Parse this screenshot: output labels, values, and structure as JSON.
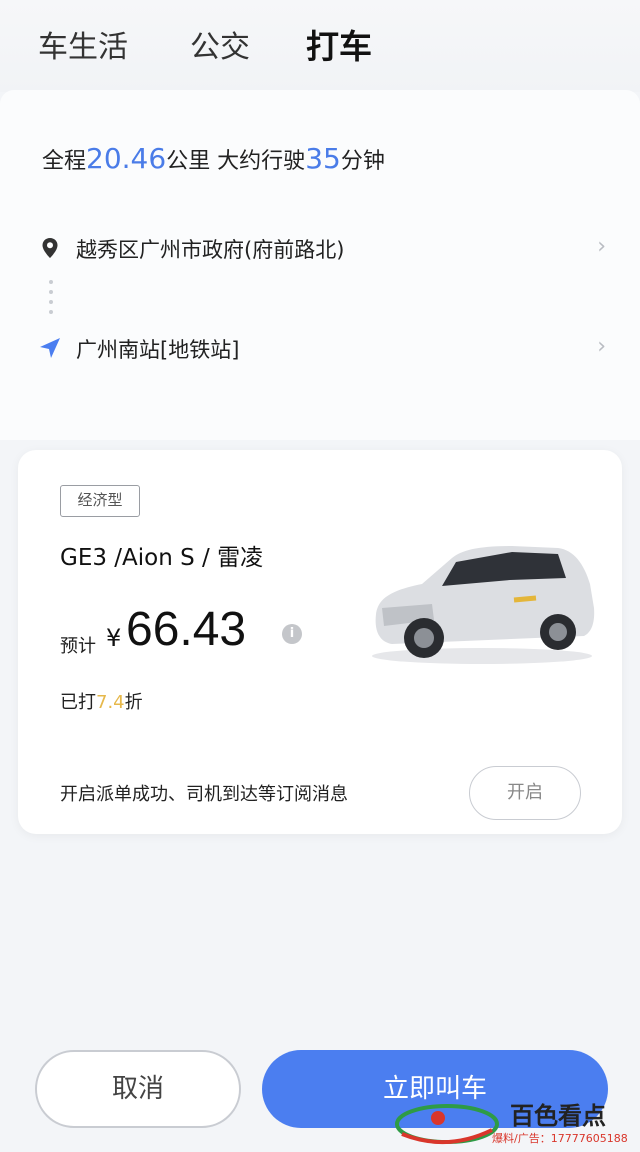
{
  "tabs": [
    {
      "label": "车生活"
    },
    {
      "label": "公交"
    },
    {
      "label": "打车"
    }
  ],
  "route": {
    "summary_prefix": "全程",
    "distance": "20.46",
    "summary_mid": "公里 大约行驶",
    "duration": "35",
    "summary_suffix": "分钟",
    "origin": "越秀区广州市政府(府前路北)",
    "destination": "广州南站[地铁站]"
  },
  "car": {
    "badge": "经济型",
    "models": "GE3 /Aion S / 雷凌",
    "price_prefix": "预计",
    "currency": "¥",
    "price": "66.43",
    "discount_prefix": "已打",
    "discount": "7.4",
    "discount_suffix": "折",
    "subscribe_text": "开启派单成功、司机到达等订阅消息",
    "subscribe_button": "开启"
  },
  "actions": {
    "cancel": "取消",
    "call": "立即叫车"
  },
  "watermark": {
    "title": "百色看点",
    "subtitle": "爆料/广告：17777605188"
  },
  "colors": {
    "accent": "#4b7ef0",
    "highlight": "#4a7ce8",
    "discount": "#e6b84b"
  }
}
